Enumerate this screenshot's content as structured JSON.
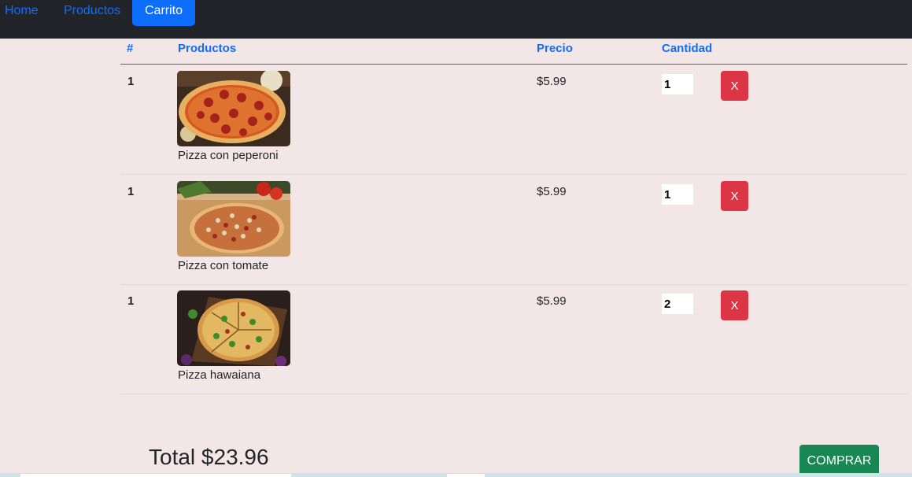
{
  "nav": {
    "home": "Home",
    "productos": "Productos",
    "carrito": "Carrito"
  },
  "table": {
    "headers": {
      "num": "#",
      "productos": "Productos",
      "precio": "Precio",
      "cantidad": "Cantidad"
    },
    "rows": [
      {
        "idx": "1",
        "name": "Pizza con peperoni",
        "price": "$5.99",
        "qty": "1",
        "delete_label": "X",
        "image": "pizza-peperoni-photo"
      },
      {
        "idx": "1",
        "name": "Pizza con tomate",
        "price": "$5.99",
        "qty": "1",
        "delete_label": "X",
        "image": "pizza-tomate-photo"
      },
      {
        "idx": "1",
        "name": "Pizza hawaiana",
        "price": "$5.99",
        "qty": "2",
        "delete_label": "X",
        "image": "pizza-hawaiana-photo"
      }
    ]
  },
  "footer": {
    "total": "Total $23.96",
    "buy_label": "COMPRAR"
  },
  "colors": {
    "background": "#f3e6e7",
    "navbar": "#212529",
    "primary": "#0d6efd",
    "danger": "#dc3545",
    "success": "#198754"
  }
}
